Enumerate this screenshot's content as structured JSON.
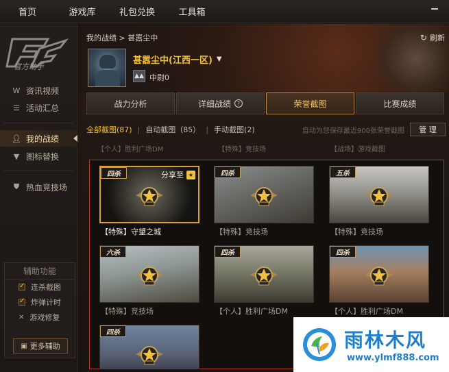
{
  "topnav": {
    "items": [
      "首页",
      "游戏库",
      "礼包兑换",
      "工具箱"
    ]
  },
  "sidebar": {
    "logo_text": "官方助手",
    "items": [
      {
        "label": "资讯视频",
        "icon": "w-icon"
      },
      {
        "label": "活动汇总",
        "icon": "list-icon"
      },
      {
        "label": "我的战绩",
        "icon": "user-icon",
        "active": true
      },
      {
        "label": "图标替换",
        "icon": "shirt-icon"
      },
      {
        "label": "热血竞技场",
        "icon": "shield-icon"
      }
    ],
    "aux": {
      "title": "辅助功能",
      "options": [
        {
          "label": "连杀截图",
          "checked": true
        },
        {
          "label": "炸弹计时",
          "checked": true
        },
        {
          "label": "游戏修复",
          "checked": false
        }
      ],
      "more_button": "更多辅助"
    }
  },
  "header": {
    "breadcrumb": "我的战绩 > 甚嚣尘中",
    "refresh_label": "刷新",
    "username": "甚嚣尘中(江西一区)",
    "rank": "中尉0"
  },
  "tabs": [
    {
      "label": "战力分析",
      "active": false
    },
    {
      "label": "详细战绩",
      "active": false,
      "help": "?"
    },
    {
      "label": "荣誉截图",
      "active": true
    },
    {
      "label": "比赛成绩",
      "active": false
    }
  ],
  "filters": {
    "all": "全部截图(87)",
    "auto": "自动截图（85）",
    "manual": "手动截图(2)",
    "note": "自动为您保存最近900张荣誉截图",
    "manage": "管 理"
  },
  "partial_row": [
    "【个人】胜利广场DM",
    "【特殊】竞技场",
    "【战场】游戏截图"
  ],
  "screenshots": [
    {
      "tag": "四杀",
      "caption": "【特殊】守望之城",
      "selected": true,
      "share": "分享至"
    },
    {
      "tag": "四杀",
      "caption": "【特殊】竞技场",
      "selected": false
    },
    {
      "tag": "五杀",
      "caption": "【特殊】竞技场",
      "selected": false
    },
    {
      "tag": "六杀",
      "caption": "【特殊】竞技场",
      "selected": false
    },
    {
      "tag": "四杀",
      "caption": "【个人】胜利广场DM",
      "selected": false
    },
    {
      "tag": "四杀",
      "caption": "【个人】胜利广场DM",
      "selected": false
    },
    {
      "tag": "四杀",
      "caption": "",
      "selected": false
    }
  ],
  "watermark": {
    "title": "雨林木风",
    "url": "www.ylmf888.com"
  },
  "colors": {
    "accent_gold": "#f0c040",
    "active_tab_border": "#b98a46",
    "grid_border": "#b93a2a",
    "watermark_blue": "#1f7fcd"
  }
}
